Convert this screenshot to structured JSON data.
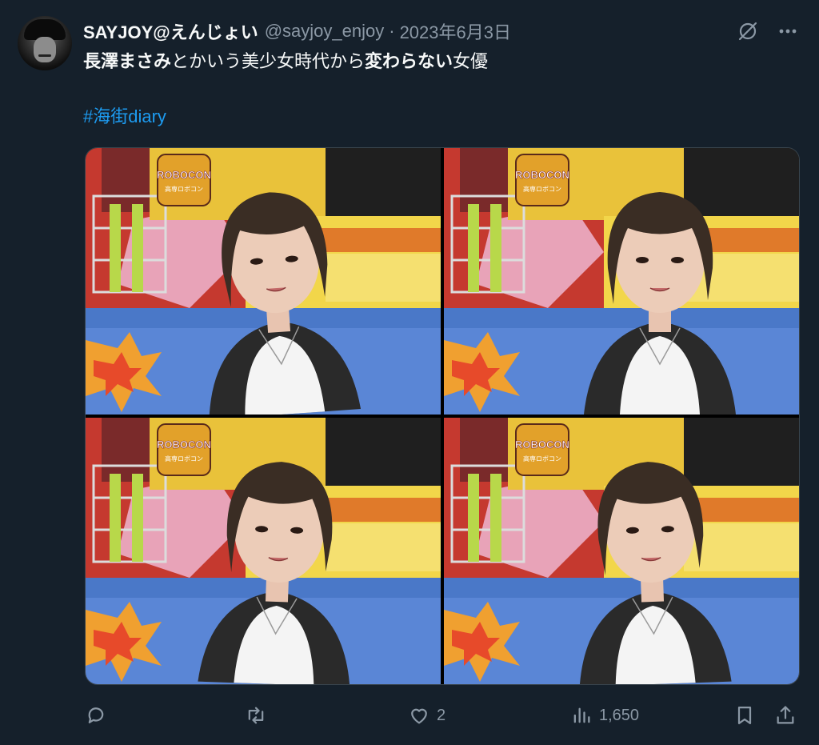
{
  "author": {
    "display_name": "SAYJOY@えんじょい",
    "handle": "@sayjoy_enjoy",
    "separator": "·",
    "date": "2023年6月3日"
  },
  "tweet": {
    "text_parts": [
      {
        "text": "長澤まさみ",
        "bold": true
      },
      {
        "text": "とかいう美少女時代から",
        "bold": false
      },
      {
        "text": "変わらない",
        "bold": true
      },
      {
        "text": "女優",
        "bold": false
      }
    ],
    "hashtag": "#海街diary"
  },
  "media": {
    "photo_count": 4,
    "sign_text": "ROBOCON",
    "sign_subtext": "高専ロボコン"
  },
  "actions": {
    "reply_count": "",
    "retweet_count": "",
    "like_count": "2",
    "view_count": "1,650"
  },
  "colors": {
    "background": "#15202b",
    "text": "#f7f9f9",
    "muted": "#8b98a5",
    "link": "#1d9bf0"
  },
  "icons": [
    "grok-icon",
    "more-icon",
    "reply-icon",
    "retweet-icon",
    "like-icon",
    "views-icon",
    "bookmark-icon",
    "share-icon"
  ]
}
